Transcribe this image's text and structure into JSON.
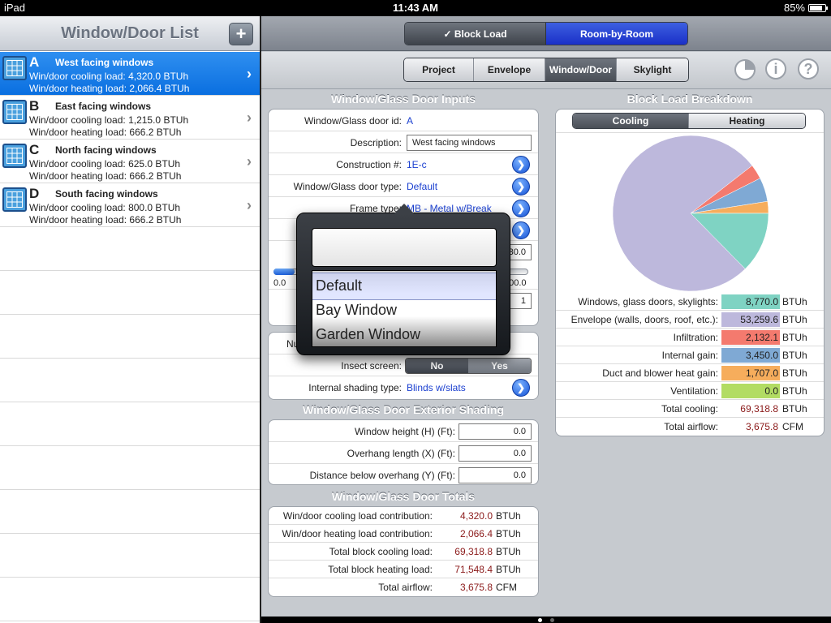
{
  "status": {
    "device": "iPad",
    "time": "11:43 AM",
    "battery": "85%",
    "battery_level": 0.85
  },
  "left": {
    "title": "Window/Door List",
    "add_label": "+",
    "items": [
      {
        "letter": "A",
        "title": "West facing windows",
        "cooling": "Win/door cooling load: 4,320.0 BTUh",
        "heating": "Win/door heating load: 2,066.4 BTUh",
        "selected": true
      },
      {
        "letter": "B",
        "title": "East facing windows",
        "cooling": "Win/door cooling load: 1,215.0 BTUh",
        "heating": "Win/door heating load: 666.2 BTUh",
        "selected": false
      },
      {
        "letter": "C",
        "title": "North facing windows",
        "cooling": "Win/door cooling load: 625.0 BTUh",
        "heating": "Win/door heating load: 666.2 BTUh",
        "selected": false
      },
      {
        "letter": "D",
        "title": "South facing windows",
        "cooling": "Win/door cooling load: 800.0 BTUh",
        "heating": "Win/door heating load: 666.2 BTUh",
        "selected": false
      }
    ]
  },
  "topseg": {
    "block": "✓ Block Load",
    "room": "Room-by-Room"
  },
  "tabs": {
    "project": "Project",
    "envelope": "Envelope",
    "windoor": "Window/Door",
    "skylight": "Skylight"
  },
  "icons": {
    "chart": "pie-chart-icon",
    "info": "info-icon",
    "help": "help-icon"
  },
  "icon_glyphs": {
    "info": "i",
    "help": "?",
    "chevron": "›",
    "arrow": "❯"
  },
  "inputs": {
    "header": "Window/Glass Door Inputs",
    "id_label": "Window/Glass door id:",
    "id_value": "A",
    "desc_label": "Description:",
    "desc_value": "West facing windows",
    "constr_label": "Construction #:",
    "constr_value": "1E-c",
    "type_label": "Window/Glass door type:",
    "type_value": "Default",
    "frame_label": "Frame type:",
    "frame_value": "MB - Metal w/Break",
    "partial_field": "30.0",
    "slider_min": "0.0",
    "slider_max": "100.0",
    "qty_value": "1",
    "num_label_partial": "Nu",
    "insect_label": "Insect screen:",
    "no": "No",
    "yes": "Yes",
    "shading_label": "Internal shading type:",
    "shading_value": "Blinds w/slats"
  },
  "picker": {
    "options": [
      "Default",
      "Bay Window",
      "Garden Window"
    ],
    "selected": "Default"
  },
  "exterior": {
    "header": "Window/Glass Door Exterior Shading",
    "height_label": "Window height (H) (Ft):",
    "height_value": "0.0",
    "overhang_label": "Overhang length (X) (Ft):",
    "overhang_value": "0.0",
    "below_label": "Distance below overhang (Y) (Ft):",
    "below_value": "0.0"
  },
  "totals": {
    "header": "Window/Glass Door Totals",
    "rows": [
      {
        "label": "Win/door cooling load contribution:",
        "value": "4,320.0",
        "unit": "BTUh"
      },
      {
        "label": "Win/door heating load contribution:",
        "value": "2,066.4",
        "unit": "BTUh"
      },
      {
        "label": "Total block cooling load:",
        "value": "69,318.8",
        "unit": "BTUh"
      },
      {
        "label": "Total block heating load:",
        "value": "71,548.4",
        "unit": "BTUh"
      },
      {
        "label": "Total airflow:",
        "value": "3,675.8",
        "unit": "CFM"
      }
    ]
  },
  "breakdown": {
    "header": "Block Load Breakdown",
    "cooling_tab": "Cooling",
    "heating_tab": "Heating",
    "rows": [
      {
        "label": "Windows, glass doors, skylights:",
        "value": "8,770.0",
        "unit": "BTUh",
        "color": "#7fd3c3"
      },
      {
        "label": "Envelope (walls, doors, roof, etc.):",
        "value": "53,259.6",
        "unit": "BTUh",
        "color": "#bdb8dc"
      },
      {
        "label": "Infiltration:",
        "value": "2,132.1",
        "unit": "BTUh",
        "color": "#f47a6e"
      },
      {
        "label": "Internal gain:",
        "value": "3,450.0",
        "unit": "BTUh",
        "color": "#7fa9d4"
      },
      {
        "label": "Duct and blower heat gain:",
        "value": "1,707.0",
        "unit": "BTUh",
        "color": "#f6ad5c"
      },
      {
        "label": "Ventilation:",
        "value": "0.0",
        "unit": "BTUh",
        "color": "#b2dc63"
      }
    ],
    "total_cool_label": "Total cooling:",
    "total_cool_value": "69,318.8",
    "total_cool_unit": "BTUh",
    "airflow_label": "Total airflow:",
    "airflow_value": "3,675.8",
    "airflow_unit": "CFM"
  },
  "chart_data": {
    "type": "pie",
    "categories": [
      "Windows, glass doors, skylights",
      "Envelope (walls, doors, roof, etc.)",
      "Infiltration",
      "Internal gain",
      "Duct and blower heat gain",
      "Ventilation"
    ],
    "values": [
      8770.0,
      53259.6,
      2132.1,
      3450.0,
      1707.0,
      0.0
    ],
    "colors": [
      "#7fd3c3",
      "#bdb8dc",
      "#f47a6e",
      "#7fa9d4",
      "#f6ad5c",
      "#b2dc63"
    ]
  }
}
